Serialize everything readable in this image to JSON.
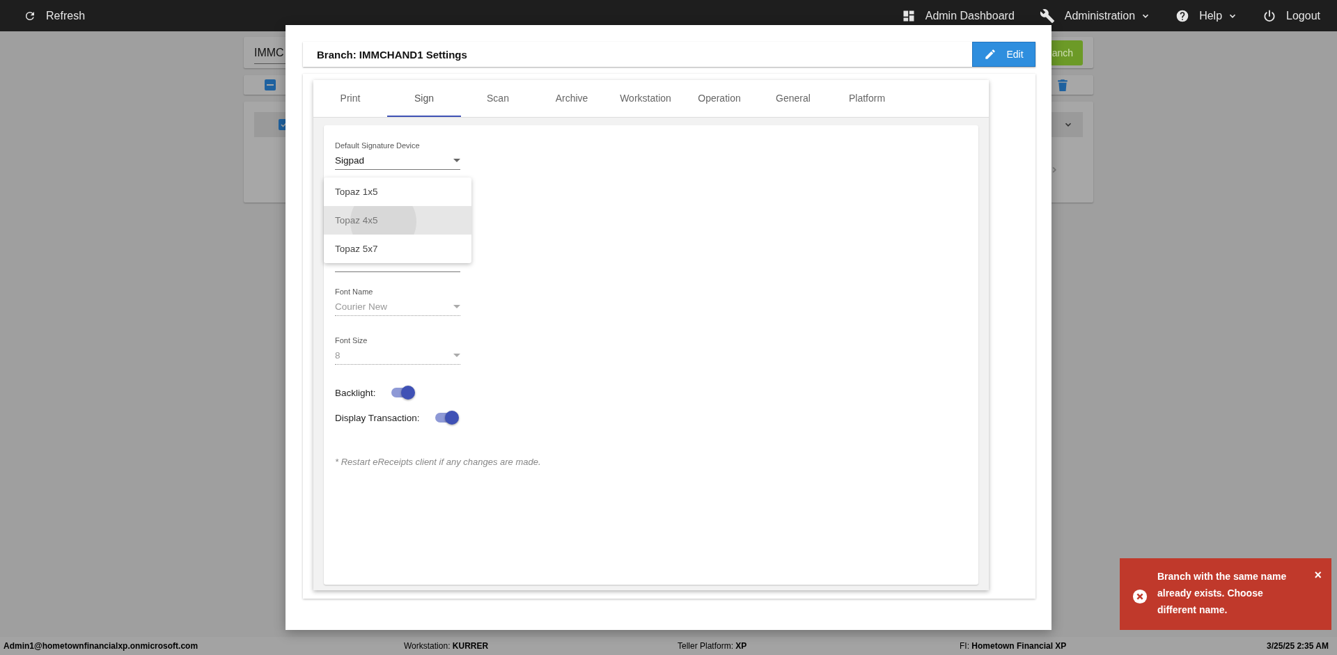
{
  "top_bar": {
    "left": [
      {
        "label": "Refresh",
        "kind": "refresh"
      }
    ],
    "right": [
      {
        "label": "Admin Dashboard",
        "kind": "dashboard",
        "dropdown": false
      },
      {
        "label": "Administration",
        "kind": "wrench",
        "dropdown": true
      },
      {
        "label": "Help",
        "kind": "help",
        "dropdown": true
      },
      {
        "label": "Logout",
        "kind": "power",
        "dropdown": false
      }
    ]
  },
  "background_page": {
    "branch_field": {
      "value": "IMMC"
    },
    "add_button": {
      "label": "anch"
    },
    "select_all": {
      "indeterminate": true
    },
    "branch_row": {
      "checked": true
    }
  },
  "modal": {
    "title": "Branch: IMMCHAND1 Settings",
    "edit_button": "Edit",
    "tabs": [
      {
        "label": "Print",
        "selected": false
      },
      {
        "label": "Sign",
        "selected": true
      },
      {
        "label": "Scan",
        "selected": false
      },
      {
        "label": "Archive",
        "selected": false
      },
      {
        "label": "Workstation",
        "selected": false
      },
      {
        "label": "Operation",
        "selected": false
      },
      {
        "label": "General",
        "selected": false
      },
      {
        "label": "Platform",
        "selected": false
      }
    ],
    "fields": [
      {
        "kind": "select",
        "label": "Default Signature Device",
        "value": "Sigpad",
        "disabled": false,
        "focused": false
      },
      {
        "kind": "menu_space"
      },
      {
        "kind": "select",
        "label": "Font Name",
        "value": "Courier New",
        "disabled": true,
        "focused": false
      },
      {
        "kind": "select",
        "label": "Font Size",
        "value": "8",
        "disabled": true,
        "focused": false
      },
      {
        "kind": "toggle",
        "label": "Backlight:",
        "on": true
      },
      {
        "kind": "toggle",
        "label": "Display Transaction:",
        "on": true
      }
    ],
    "note": "* Restart eReceipts client if any changes are made.",
    "dropdown_menu": {
      "items": [
        {
          "label": "Topaz 1x5",
          "selected": false
        },
        {
          "label": "Topaz 4x5",
          "selected": true
        },
        {
          "label": "Topaz 5x7",
          "selected": false
        }
      ]
    }
  },
  "toast": {
    "message": "Branch with the same name already exists. Choose different name.",
    "close": "×"
  },
  "status_bar": {
    "user": "Admin1@hometownfinancialxp.onmicrosoft.com",
    "fields": [
      "Workstation: **KURRER**",
      "Teller Platform: **XP**",
      "FI: **Hometown Financial XP**"
    ],
    "datetime": "3/25/25 2:35 AM"
  }
}
